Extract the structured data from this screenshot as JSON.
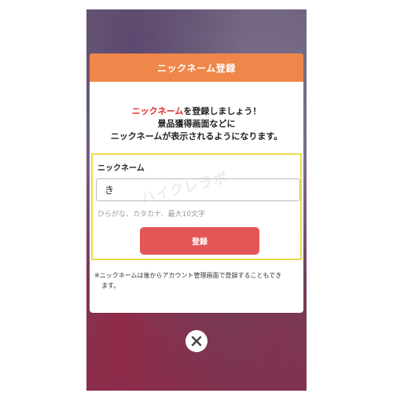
{
  "modal": {
    "title": "ニックネーム登録",
    "intro": {
      "accent": "ニックネーム",
      "line1_rest": "を登録しましょう！",
      "line2": "景品獲得画面などに",
      "line3": "ニックネームが表示されるようになります。"
    },
    "field": {
      "label": "ニックネーム",
      "value": "き",
      "hint": "ひらがな、カタカナ、最大10文字"
    },
    "watermark": "ハイクレラボ",
    "submit_label": "登録",
    "note_line1": "※ニックネームは後からアカウント管理画面で登録することもでき",
    "note_line2": "ます。"
  },
  "close": {
    "icon": "close-icon"
  },
  "colors": {
    "header": "#f0874a",
    "accent_text": "#e02a2a",
    "button": "#e45656",
    "highlight_border": "#e9dc43"
  }
}
